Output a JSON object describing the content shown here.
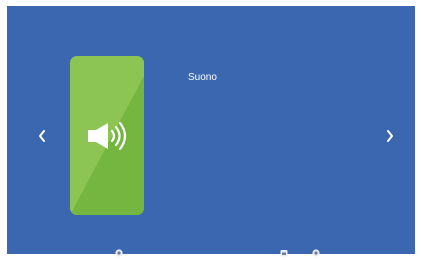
{
  "settings": {
    "current_item_label": "Suono",
    "card_icon": "speaker-volume-icon"
  },
  "navigation": {
    "left_icon": "chevron-left-icon",
    "right_icon": "chevron-right-icon"
  },
  "bottom_bar": {
    "icons": [
      "gear-icon",
      "folder-icon",
      "gear-icon"
    ]
  },
  "colors": {
    "background": "#3a67b0",
    "card_green": "#8cc554",
    "card_green_dark": "#74b63f",
    "text": "#ffffff"
  }
}
